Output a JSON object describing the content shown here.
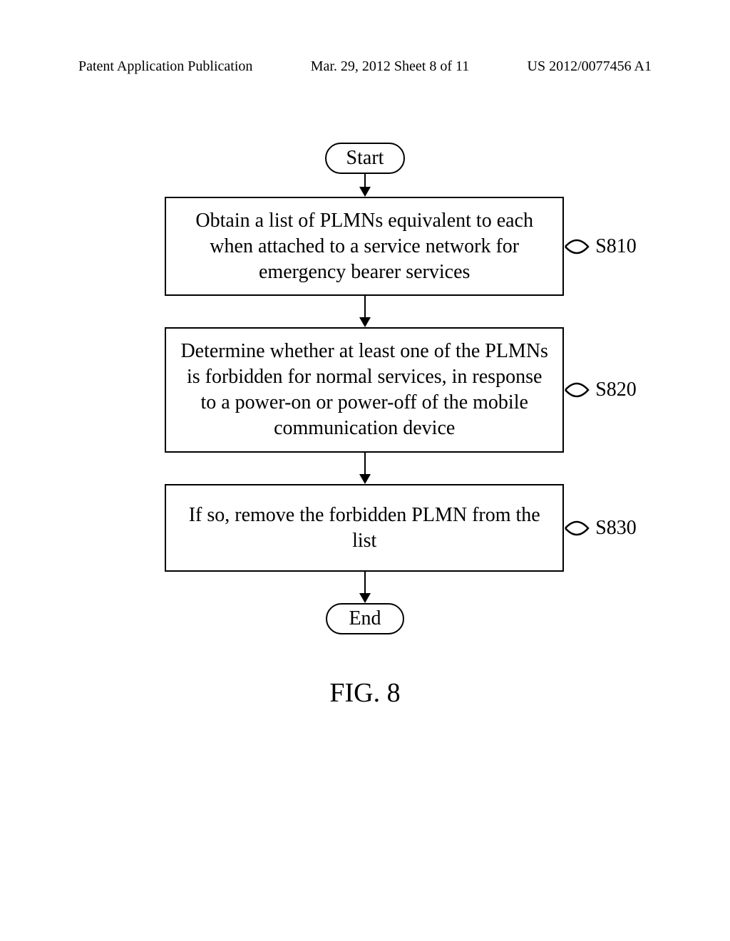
{
  "header": {
    "left": "Patent Application Publication",
    "center": "Mar. 29, 2012  Sheet 8 of 11",
    "right": "US 2012/0077456 A1"
  },
  "flow": {
    "start": "Start",
    "end": "End",
    "steps": [
      {
        "text": "Obtain a list of PLMNs equivalent to each when attached to a service network for emergency bearer services",
        "label": "S810"
      },
      {
        "text": "Determine whether at least one of the PLMNs is forbidden for normal services, in response to a power-on or power-off of the mobile communication device",
        "label": "S820"
      },
      {
        "text": "If so, remove the forbidden PLMN from the list",
        "label": "S830"
      }
    ]
  },
  "figure_caption": "FIG. 8"
}
